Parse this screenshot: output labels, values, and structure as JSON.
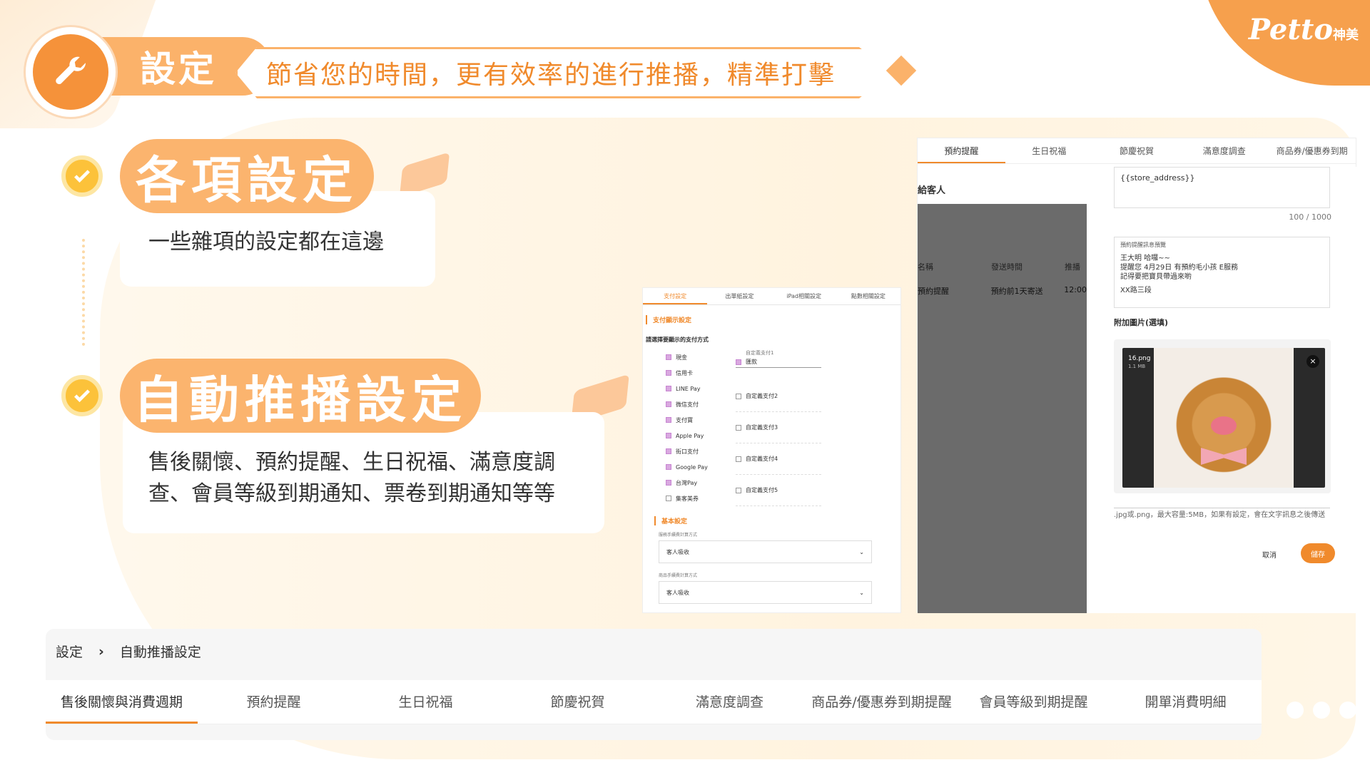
{
  "header": {
    "title": "設定",
    "banner": "節省您的時間，更有效率的進行推播，精準打擊"
  },
  "logo": {
    "brand": "Petto",
    "suffix": "神美"
  },
  "sections": [
    {
      "pill": "各項設定",
      "desc": "一些雜項的設定都在這邊"
    },
    {
      "pill": "自動推播設定",
      "desc_line1": "售後關懷、預約提醒、生日祝福、滿意度調",
      "desc_line2": "查、會員等級到期通知、票卷到期通知等等"
    }
  ],
  "mid": {
    "tabs": [
      "支付設定",
      "出單紙設定",
      "iPad相關設定",
      "點數相關設定"
    ],
    "section1": "支付顯示設定",
    "prompt": "請選擇要顯示的支付方式",
    "methods": [
      {
        "label": "現金",
        "checked": true
      },
      {
        "label": "信用卡",
        "checked": true
      },
      {
        "label": "LINE Pay",
        "checked": true
      },
      {
        "label": "微信支付",
        "checked": true
      },
      {
        "label": "支付寶",
        "checked": true
      },
      {
        "label": "Apple Pay",
        "checked": true
      },
      {
        "label": "街口支付",
        "checked": true
      },
      {
        "label": "Google Pay",
        "checked": true
      },
      {
        "label": "台灣Pay",
        "checked": true
      },
      {
        "label": "集客美券",
        "checked": false
      }
    ],
    "custom_label": "自定義支付1",
    "custom_value": "匯款",
    "customs": [
      "自定義支付2",
      "自定義支付3",
      "自定義支付4",
      "自定義支付5"
    ],
    "section2": "基本設定",
    "fee1_label": "服務手續費計算方式",
    "fee1_value": "客人吸收",
    "fee2_label": "商品手續費計算方式",
    "fee2_value": "客人吸收"
  },
  "right": {
    "tabs": [
      "預約提醒",
      "生日祝福",
      "節慶祝賀",
      "滿意度調查",
      "商品券/優惠券到期"
    ],
    "to_customer": "給客人",
    "table_headers": [
      "名稱",
      "發送時間",
      "推播"
    ],
    "table_row": [
      "預約提醒",
      "預約前1天寄送",
      "12:00"
    ],
    "store_field": "{{store_address}}",
    "char_count": "100 / 1000",
    "preview_label": "預約提醒訊息預覽",
    "preview_lines": [
      "王大明 哈囉~~",
      "提醒您 4月29日 有預約毛小孩 E服務",
      "記得要把寶貝帶過來喲",
      "XX路三段"
    ],
    "attach_label": "附加圖片(選填)",
    "file_name": "16.png",
    "file_size": "1.1 MB",
    "hint": ".jpg或.png，最大容量:5MB，如果有設定，會在文字訊息之後傳送",
    "cancel": "取消",
    "save": "儲存"
  },
  "bottom": {
    "breadcrumb_root": "設定",
    "breadcrumb_current": "自動推播設定",
    "tabs": [
      "售後關懷與消費週期",
      "預約提醒",
      "生日祝福",
      "節慶祝賀",
      "滿意度調查",
      "商品券/優惠券到期提醒",
      "會員等級到期提醒",
      "開單消費明細"
    ]
  },
  "colors": {
    "accent": "#f08a2c",
    "pill": "#fbb46e",
    "check": "#fcc23a"
  }
}
